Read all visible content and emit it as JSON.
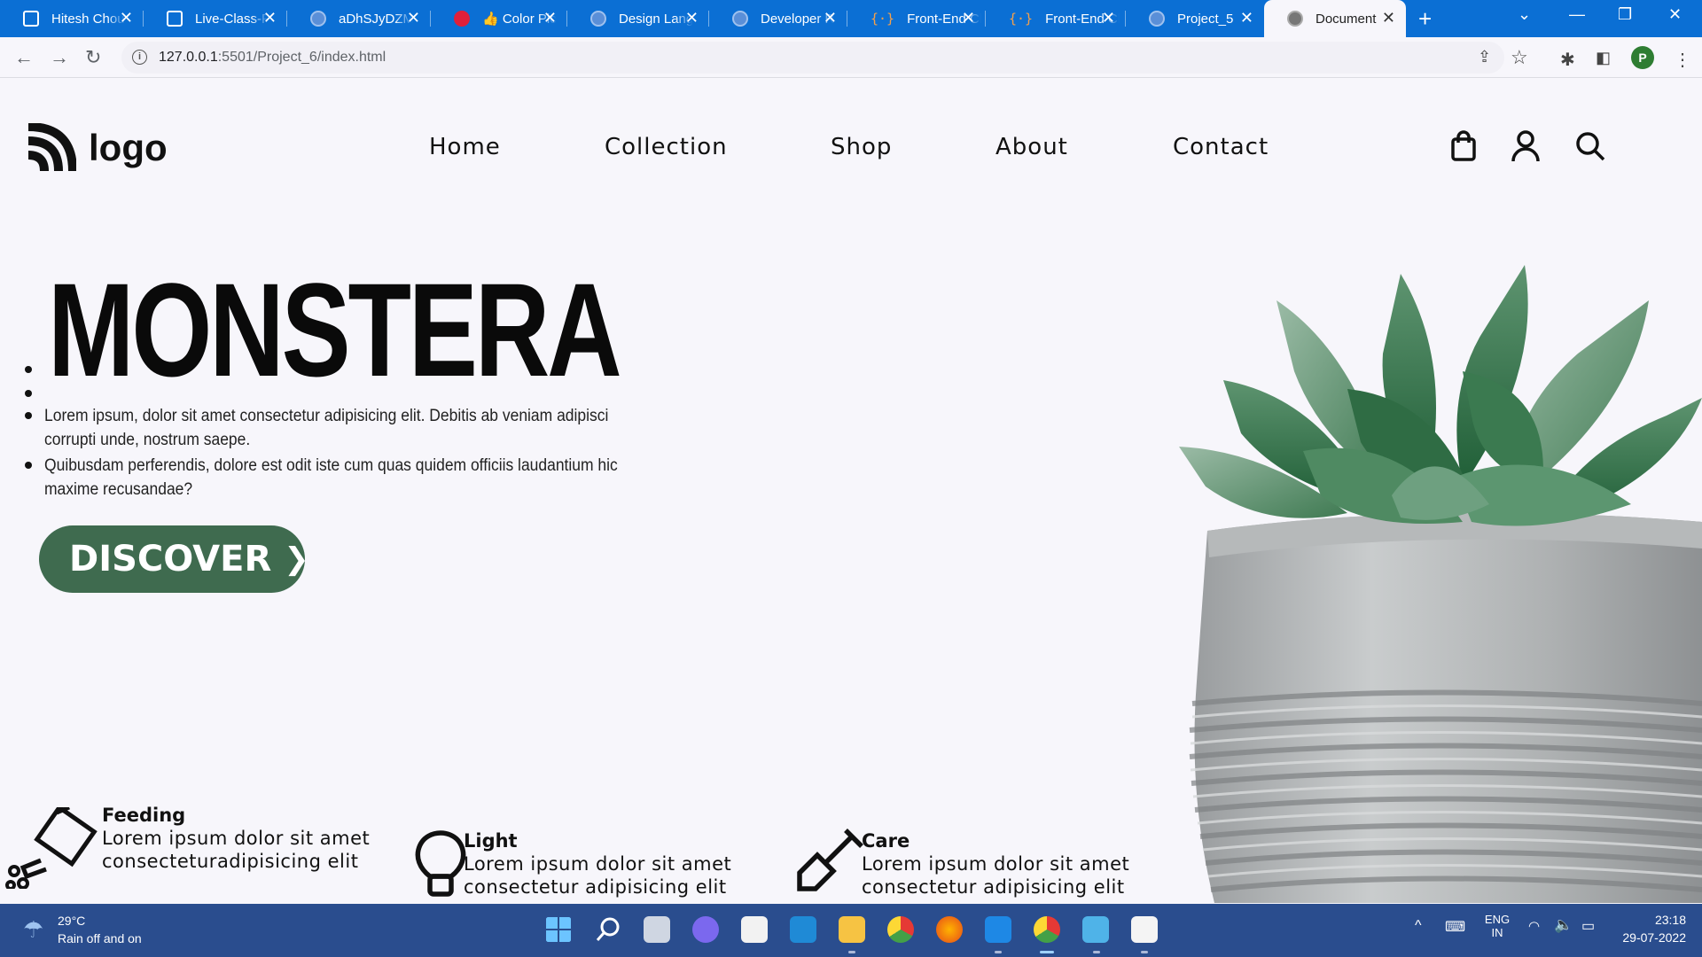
{
  "browser": {
    "tabs": [
      {
        "title": "Hitesh Choudhary",
        "icon": "square-icon"
      },
      {
        "title": "Live-Class-Frontend",
        "icon": "square-icon"
      },
      {
        "title": "aDhSJyDZMx",
        "icon": "globe-icon"
      },
      {
        "title": "👍 Color Picker",
        "icon": "color-picker-icon"
      },
      {
        "title": "Design Language",
        "icon": "globe-icon"
      },
      {
        "title": "Developer Resources",
        "icon": "globe-icon"
      },
      {
        "title": "Front-End Challenges",
        "icon": "code-braces-icon"
      },
      {
        "title": "Front-End Challenges",
        "icon": "code-braces-icon"
      },
      {
        "title": "Project_5",
        "icon": "globe-icon"
      },
      {
        "title": "Document",
        "icon": "globe-icon"
      }
    ],
    "url_host": "127.0.0.1",
    "url_path": ":5501/Project_6/index.html",
    "profile_initial": "P"
  },
  "site": {
    "logo_text": "logo",
    "nav": [
      "Home",
      "Collection",
      "Shop",
      "About",
      "Contact"
    ],
    "hero_title": "MONSTERA",
    "paragraphs": [
      "Lorem ipsum, dolor sit amet consectetur adipisicing elit. Debitis ab veniam adipisci corrupti unde, nostrum saepe.",
      "Quibusdam perferendis, dolore est odit iste cum quas quidem officiis laudantium hic maxime recusandae?"
    ],
    "cta_label": "DISCOVER",
    "features": [
      {
        "title": "Feeding",
        "line1": "Lorem ipsum dolor sit amet",
        "line2": "consecteturadipisicing elit"
      },
      {
        "title": "Light",
        "line1": "Lorem ipsum dolor sit amet",
        "line2": "consectetur adipisicing elit"
      },
      {
        "title": "Care",
        "line1": "Lorem ipsum dolor sit amet",
        "line2": "consectetur adipisicing elit"
      }
    ],
    "accent_color": "#3f6b4f"
  },
  "taskbar": {
    "weather_temp": "29°C",
    "weather_desc": "Rain off and on",
    "lang_top": "ENG",
    "lang_bottom": "IN",
    "time": "23:18",
    "date": "29-07-2022"
  }
}
